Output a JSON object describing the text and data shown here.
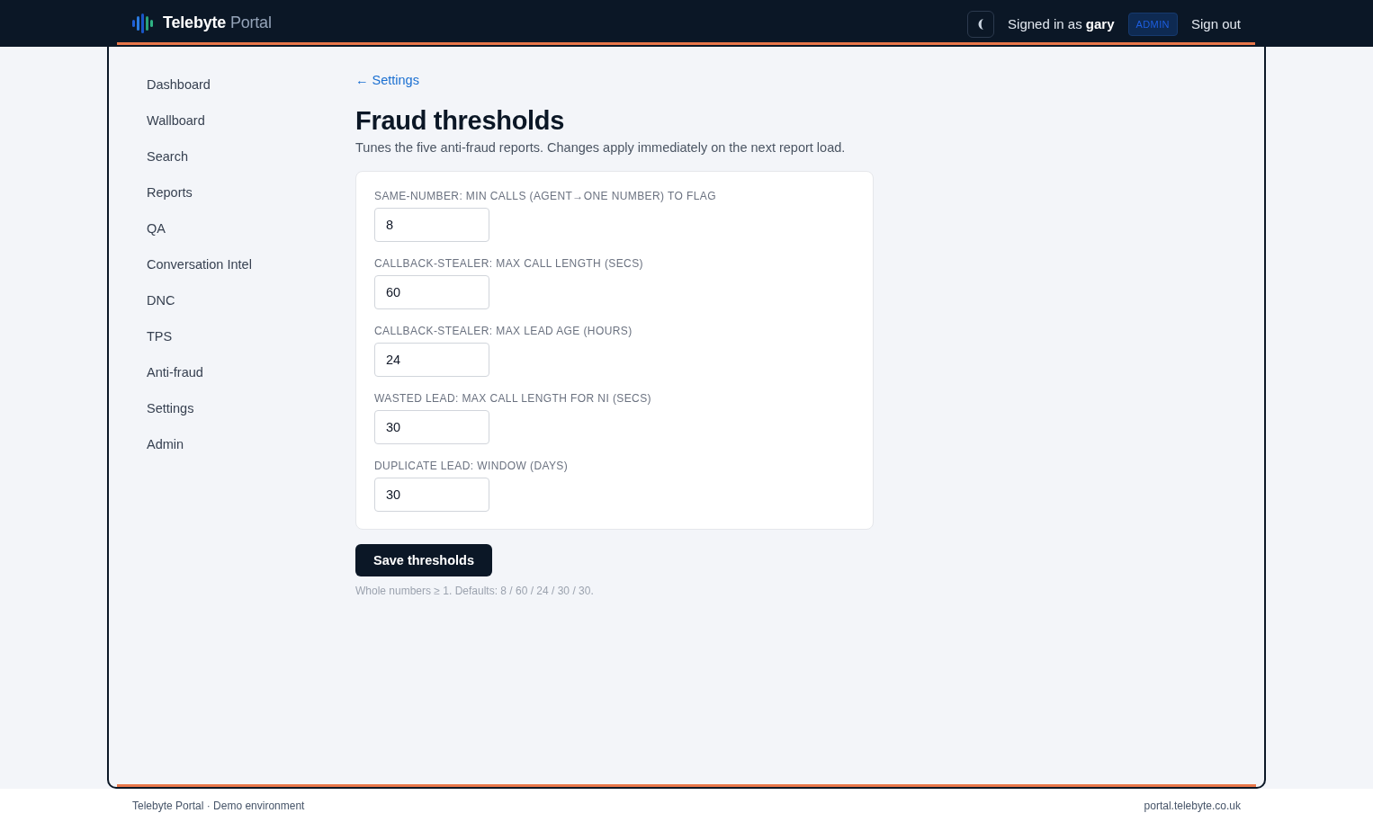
{
  "header": {
    "brand": "**Telebyte** Portal",
    "signed_in": "Signed in as **gary**",
    "role_badge": "ADMIN",
    "sign_out": "Sign out"
  },
  "sidebar": {
    "items": [
      {
        "label": "Dashboard"
      },
      {
        "label": "Wallboard"
      },
      {
        "label": "Search"
      },
      {
        "label": "Reports"
      },
      {
        "label": "QA"
      },
      {
        "label": "Conversation Intel"
      },
      {
        "label": "DNC"
      },
      {
        "label": "TPS"
      },
      {
        "label": "Anti-fraud"
      },
      {
        "label": "Settings"
      },
      {
        "label": "Admin"
      }
    ]
  },
  "page": {
    "back_link": "← Settings",
    "title": "Fraud thresholds",
    "subtitle": "Tunes the five anti-fraud reports. Changes apply immediately on the next report load."
  },
  "form": {
    "fields": [
      {
        "label": "SAME-NUMBER: MIN CALLS (AGENT→ONE NUMBER) TO FLAG",
        "value": "8"
      },
      {
        "label": "CALLBACK-STEALER: MAX CALL LENGTH (SECS)",
        "value": "60"
      },
      {
        "label": "CALLBACK-STEALER: MAX LEAD AGE (HOURS)",
        "value": "24"
      },
      {
        "label": "WASTED LEAD: MAX CALL LENGTH FOR NI (SECS)",
        "value": "30"
      },
      {
        "label": "DUPLICATE LEAD: WINDOW (DAYS)",
        "value": "30"
      }
    ],
    "submit": "Save thresholds",
    "hint": "Whole numbers ≥ 1. Defaults: 8 / 60 / 24 / 30 / 30."
  },
  "footer": {
    "left": "Telebyte Portal · Demo environment",
    "right": "portal.telebyte.co.uk"
  }
}
